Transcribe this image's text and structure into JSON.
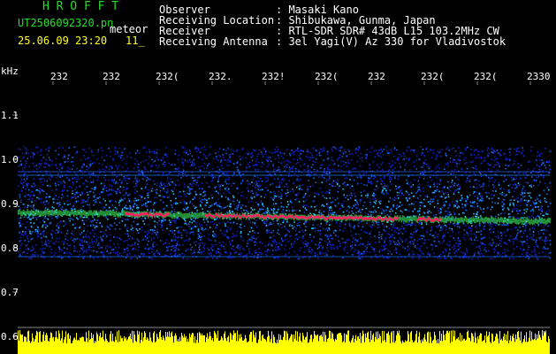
{
  "header": {
    "brand": "H R O F F T",
    "filename": "UT2506092320.pn",
    "mode": "meteor",
    "datetime": "25.06.09 23:20",
    "extra": "11_",
    "fields": [
      {
        "label": "Observer",
        "value": ": Masaki Kano"
      },
      {
        "label": "Receiving Location",
        "value": ": Shibukawa, Gunma, Japan"
      },
      {
        "label": "Receiver",
        "value": ": RTL-SDR SDR# 43dB L15 103.2MHz CW"
      },
      {
        "label": "Receiving Antenna",
        "value": ": 3el Yagi(V) Az 330 for Vladivostok"
      }
    ]
  },
  "plot": {
    "y_unit": "kHz",
    "x_ticks": [
      "232",
      "232",
      "232(",
      "232.",
      "232!",
      "232(",
      "232",
      "232(",
      "232(",
      "2330"
    ],
    "y_ticks": [
      "1.1",
      "1.0",
      "0.9",
      "0.8",
      "0.7",
      "0.6"
    ]
  },
  "colors": {
    "background": "#000000",
    "header_text": "#ffffff",
    "brand": "#22e02a",
    "time_text": "#ffff20",
    "noise_low": "#1020c0",
    "noise_high": "#20c0ff",
    "signal": "#ff2060",
    "signal_halo": "#40ff60",
    "amplitude": "#ffff00"
  }
}
